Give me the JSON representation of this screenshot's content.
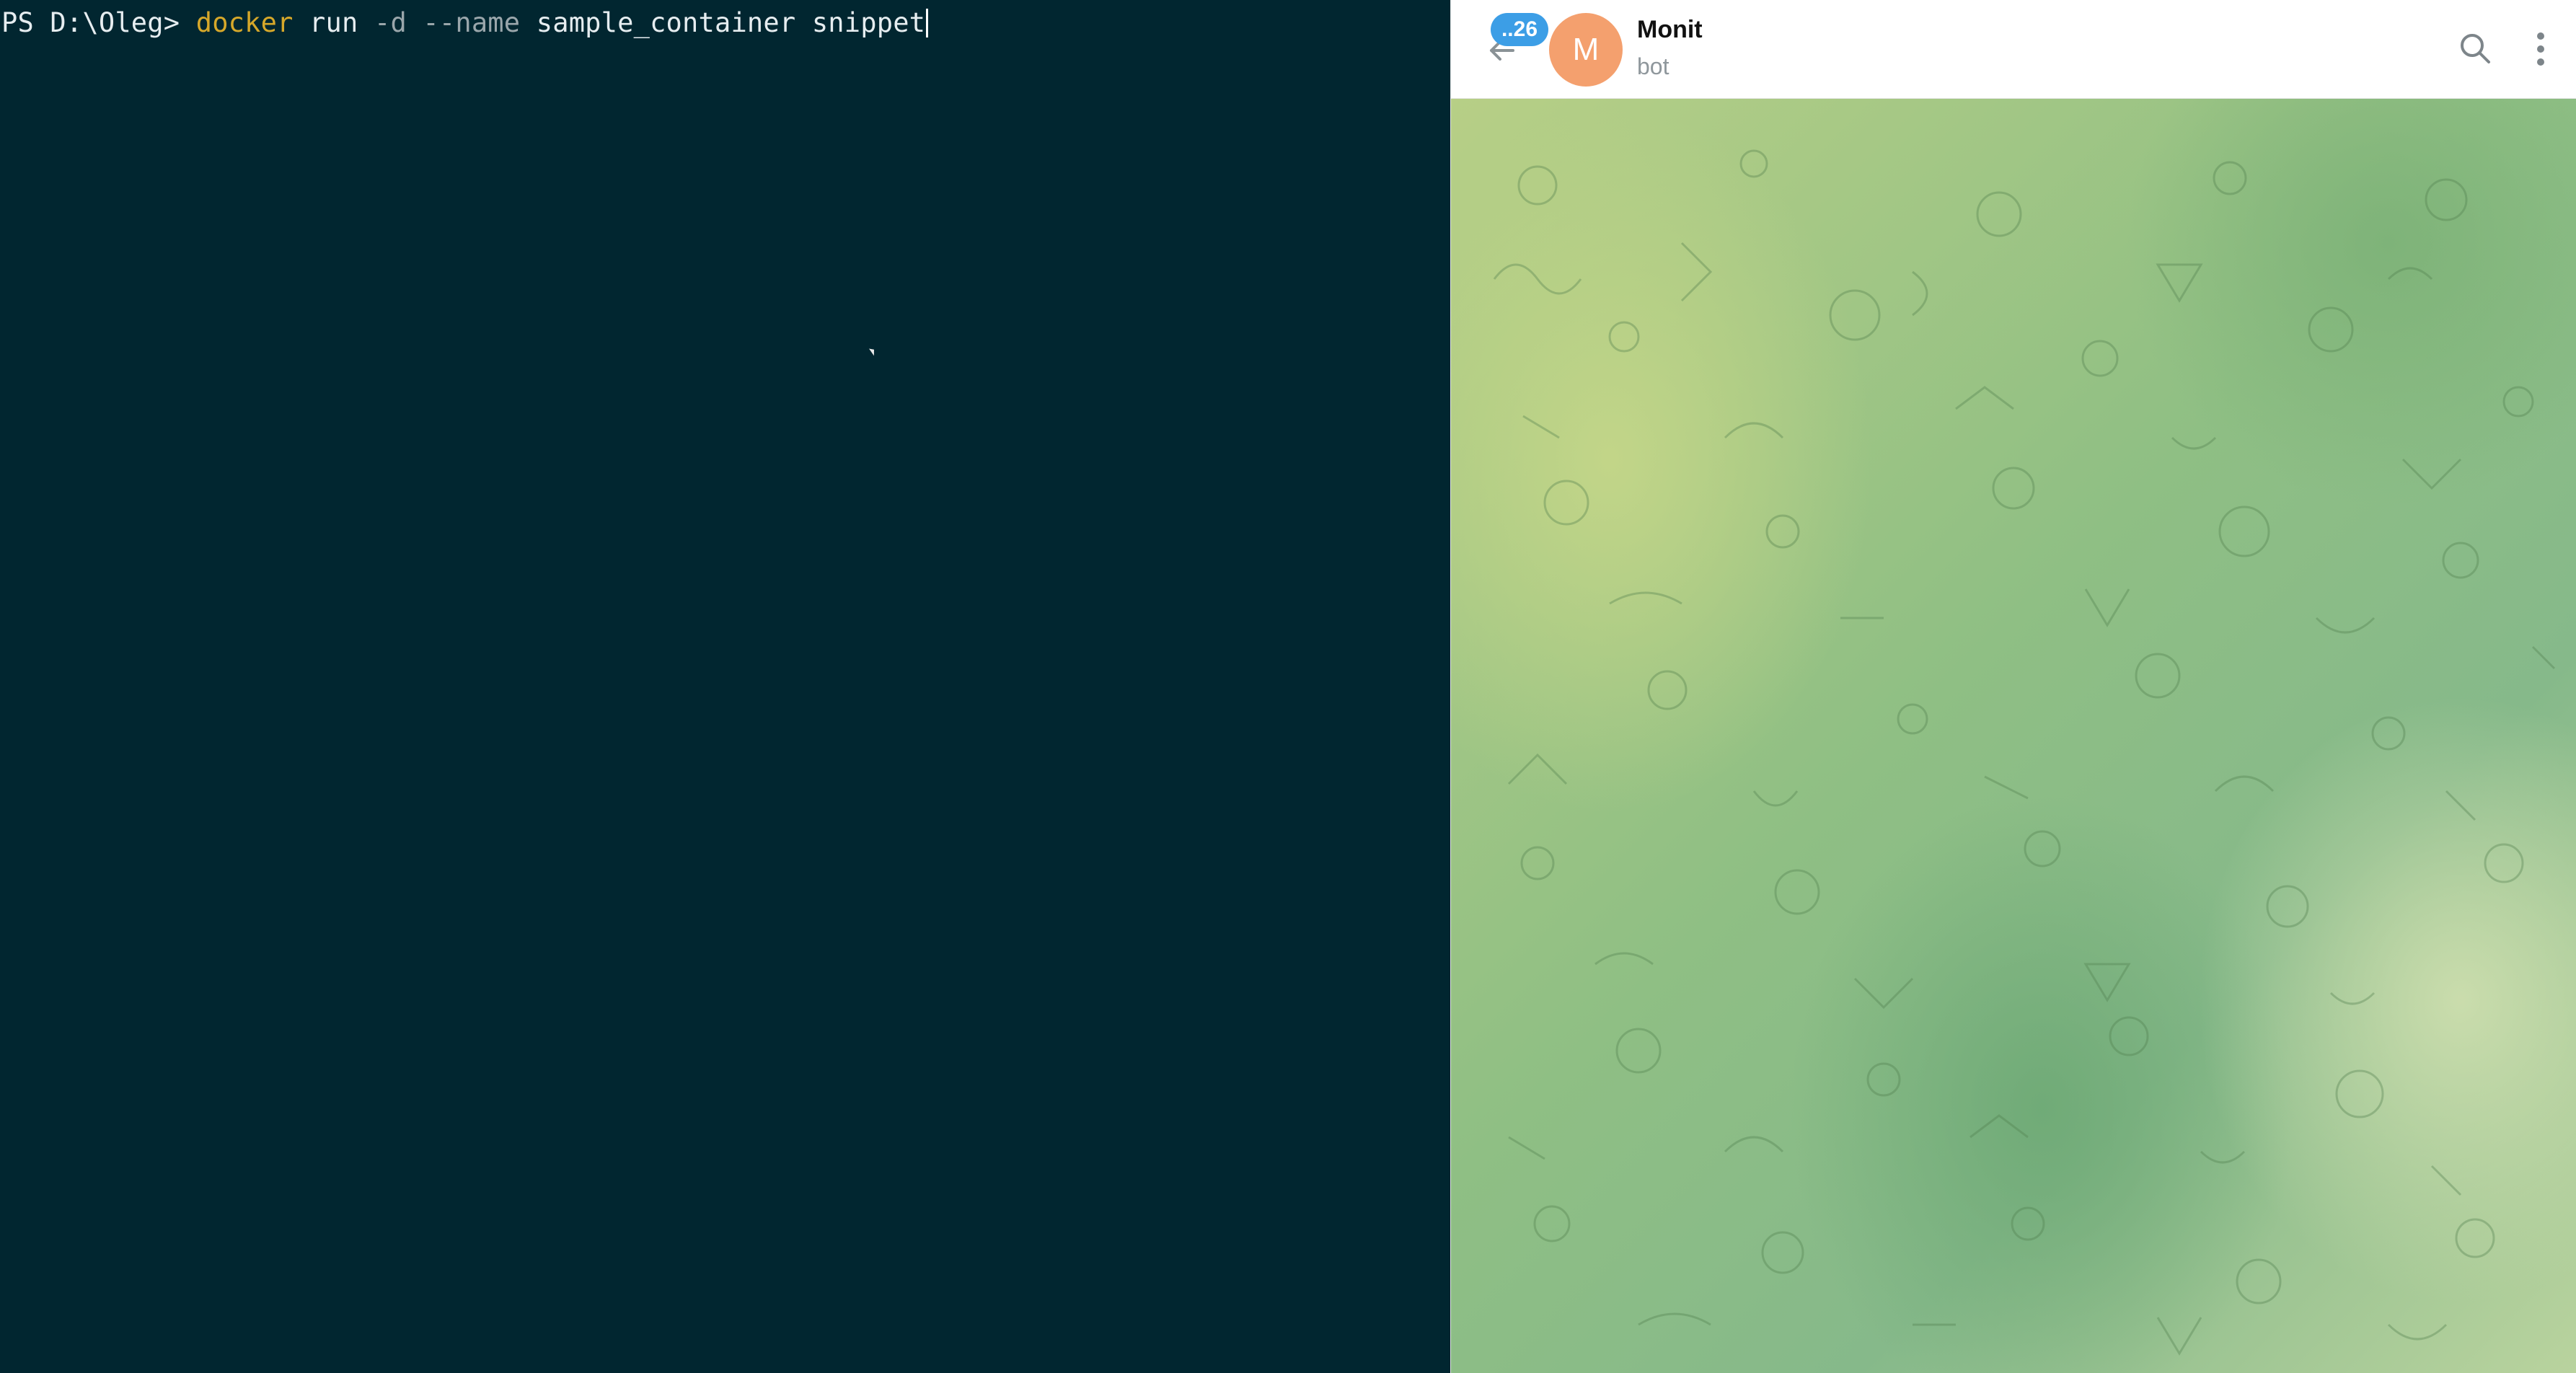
{
  "terminal": {
    "prompt": "PS D:\\Oleg> ",
    "command": "docker",
    "arg1": " run ",
    "flag1": "-d",
    "space": " ",
    "flag2": "--name",
    "args": " sample_container snippet"
  },
  "chat": {
    "unread_badge": "..26",
    "avatar_letter": "M",
    "title": "Monit",
    "status": "bot"
  },
  "colors": {
    "terminal_bg": "#012630",
    "command_accent": "#d6a82a",
    "avatar": "#f4a06e",
    "badge": "#3c9ee6"
  },
  "icons": {
    "back": "arrow-left-icon",
    "search": "search-icon",
    "menu": "more-vertical-icon"
  }
}
